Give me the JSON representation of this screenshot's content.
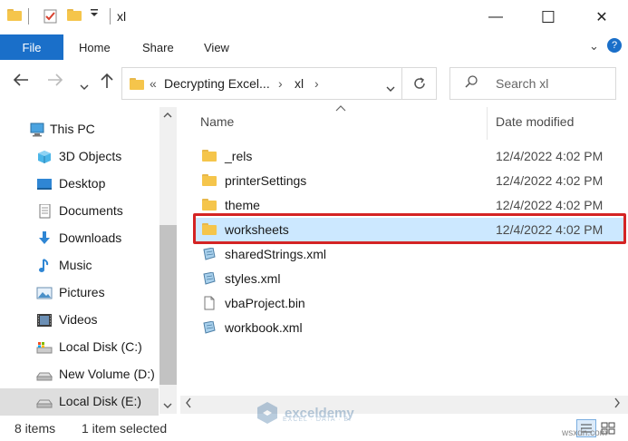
{
  "window": {
    "title": "xl",
    "minimize": "—",
    "maximize": "☐",
    "close": "✕"
  },
  "ribbon": {
    "tabs": [
      "File",
      "Home",
      "Share",
      "View"
    ],
    "collapse_glyph": "⌄",
    "help_glyph": "?"
  },
  "address": {
    "overflow": "«",
    "segments": [
      "Decrypting Excel...",
      "xl"
    ],
    "separator": "›",
    "search_placeholder": "Search xl"
  },
  "nav": {
    "items": [
      {
        "label": "This PC",
        "icon": "this-pc-icon"
      },
      {
        "label": "3D Objects",
        "icon": "3d-objects-icon"
      },
      {
        "label": "Desktop",
        "icon": "desktop-icon"
      },
      {
        "label": "Documents",
        "icon": "documents-icon"
      },
      {
        "label": "Downloads",
        "icon": "downloads-icon"
      },
      {
        "label": "Music",
        "icon": "music-icon"
      },
      {
        "label": "Pictures",
        "icon": "pictures-icon"
      },
      {
        "label": "Videos",
        "icon": "videos-icon"
      },
      {
        "label": "Local Disk (C:)",
        "icon": "local-disk-c-icon"
      },
      {
        "label": "New Volume (D:)",
        "icon": "drive-d-icon"
      },
      {
        "label": "Local Disk (E:)",
        "icon": "drive-e-icon"
      }
    ]
  },
  "columns": {
    "name": "Name",
    "date": "Date modified"
  },
  "files": [
    {
      "name": "_rels",
      "date": "12/4/2022 4:02 PM",
      "type": "folder"
    },
    {
      "name": "printerSettings",
      "date": "12/4/2022 4:02 PM",
      "type": "folder"
    },
    {
      "name": "theme",
      "date": "12/4/2022 4:02 PM",
      "type": "folder"
    },
    {
      "name": "worksheets",
      "date": "12/4/2022 4:02 PM",
      "type": "folder"
    },
    {
      "name": "sharedStrings.xml",
      "date": "",
      "type": "xml"
    },
    {
      "name": "styles.xml",
      "date": "",
      "type": "xml"
    },
    {
      "name": "vbaProject.bin",
      "date": "",
      "type": "bin"
    },
    {
      "name": "workbook.xml",
      "date": "",
      "type": "xml"
    }
  ],
  "status": {
    "count": "8 items",
    "selected": "1 item selected"
  },
  "watermark": {
    "name": "exceldemy",
    "sub": "EXCEL · DATA · BI",
    "site": "wsxdn.com"
  },
  "colors": {
    "accent": "#1a6fc9",
    "selection": "#cce8ff",
    "highlight_box": "#d42424",
    "folder": "#f5c54b"
  }
}
